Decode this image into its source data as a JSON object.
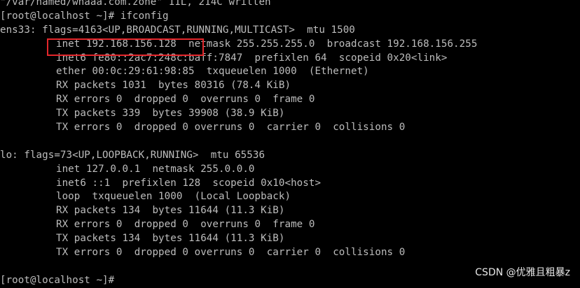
{
  "terminal": {
    "lines": [
      "\"/var/named/whaaa.com.zone\" 11L, 214C written",
      "[root@localhost ~]# ifconfig",
      "ens33: flags=4163<UP,BROADCAST,RUNNING,MULTICAST>  mtu 1500",
      "inet 192.168.156.128  netmask 255.255.255.0  broadcast 192.168.156.255",
      "inet6 fe80::2ac7:248c:baff:7847  prefixlen 64  scopeid 0x20<link>",
      "ether 00:0c:29:61:98:85  txqueuelen 1000  (Ethernet)",
      "RX packets 1031  bytes 80316 (78.4 KiB)",
      "RX errors 0  dropped 0  overruns 0  frame 0",
      "TX packets 339  bytes 39908 (38.9 KiB)",
      "TX errors 0  dropped 0 overruns 0  carrier 0  collisions 0",
      "",
      "lo: flags=73<UP,LOOPBACK,RUNNING>  mtu 65536",
      "inet 127.0.0.1  netmask 255.0.0.0",
      "inet6 ::1  prefixlen 128  scopeid 0x10<host>",
      "loop  txqueuelen 1000  (Local Loopback)",
      "RX packets 134  bytes 11644 (11.3 KiB)",
      "RX errors 0  dropped 0  overruns 0  frame 0",
      "TX packets 134  bytes 11644 (11.3 KiB)",
      "TX errors 0  dropped 0 overruns 0  carrier 0  collisions 0",
      "",
      "[root@localhost ~]#"
    ]
  },
  "watermark": "CSDN @优雅且粗暴z",
  "colors": {
    "background": "#000000",
    "text": "#bdbdbd",
    "highlight_border": "#e3262b",
    "watermark": "#e8e8e8"
  }
}
